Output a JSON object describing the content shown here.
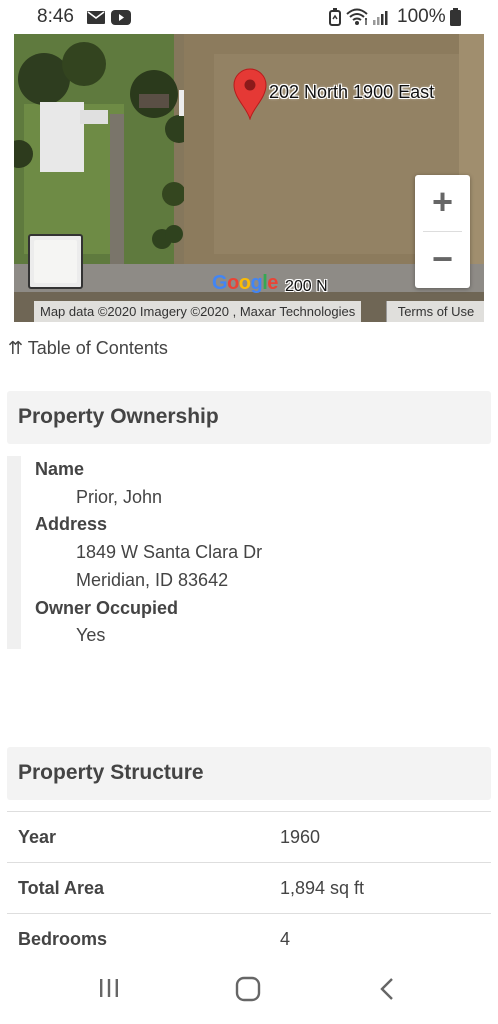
{
  "status_bar": {
    "time": "8:46",
    "battery_text": "100%"
  },
  "map": {
    "pin_label": "202 North 1900 East",
    "road_label": "200 N",
    "google_logo": [
      "G",
      "o",
      "o",
      "g",
      "l",
      "e"
    ],
    "attribution": "Map data ©2020 Imagery ©2020 , Maxar Technologies",
    "terms": "Terms of Use",
    "zoom_in": "+",
    "zoom_out": "−"
  },
  "toc": {
    "label": "⇈ Table of Contents"
  },
  "ownership": {
    "title": "Property Ownership",
    "name_label": "Name",
    "name_value": "Prior, John",
    "address_label": "Address",
    "address_line1": "1849 W Santa Clara Dr",
    "address_line2": "Meridian, ID 83642",
    "occupied_label": "Owner Occupied",
    "occupied_value": "Yes"
  },
  "structure": {
    "title": "Property Structure",
    "rows": [
      {
        "label": "Year",
        "value": "1960"
      },
      {
        "label": "Total Area",
        "value": "1,894 sq ft"
      },
      {
        "label": "Bedrooms",
        "value": "4"
      }
    ]
  },
  "colors": {
    "pin": "#E53935",
    "header_bg": "#f3f3f3"
  }
}
